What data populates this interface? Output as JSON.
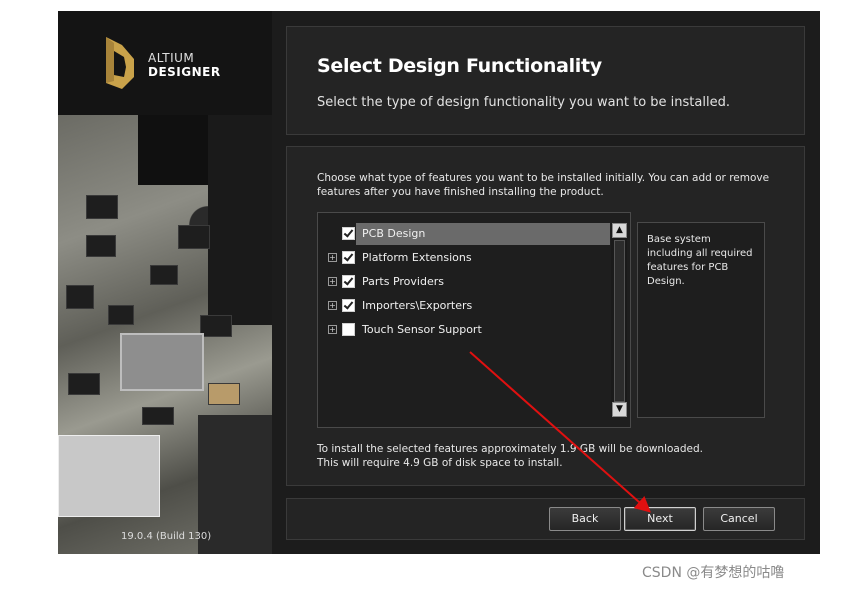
{
  "logo": {
    "line1": "ALTIUM",
    "line2": "DESIGNER"
  },
  "version": "19.0.4 (Build 130)",
  "header": {
    "title": "Select Design Functionality",
    "subtitle": "Select the type of design functionality you want to be installed."
  },
  "main": {
    "intro": "Choose what type of features you want to be installed initially. You can add or remove features after you have finished installing the product.",
    "features": [
      {
        "label": "PCB Design",
        "checked": true,
        "selected": true,
        "expandable": false
      },
      {
        "label": "Platform Extensions",
        "checked": true,
        "selected": false,
        "expandable": true
      },
      {
        "label": "Parts Providers",
        "checked": true,
        "selected": false,
        "expandable": true
      },
      {
        "label": "Importers\\Exporters",
        "checked": true,
        "selected": false,
        "expandable": true
      },
      {
        "label": "Touch Sensor Support",
        "checked": false,
        "selected": false,
        "expandable": true
      }
    ],
    "description": "Base system including all required features for PCB Design.",
    "size_line1": "To install the selected features approximately 1.9 GB will be downloaded.",
    "size_line2": "This will require 4.9 GB of disk space to install."
  },
  "footer": {
    "back_label": "Back",
    "next_label": "Next",
    "cancel_label": "Cancel"
  },
  "watermark": "CSDN @有梦想的咕噜",
  "colors": {
    "background": "#1c1c1c",
    "logo_gold": "#c9a24a",
    "arrow": "#e01010"
  }
}
